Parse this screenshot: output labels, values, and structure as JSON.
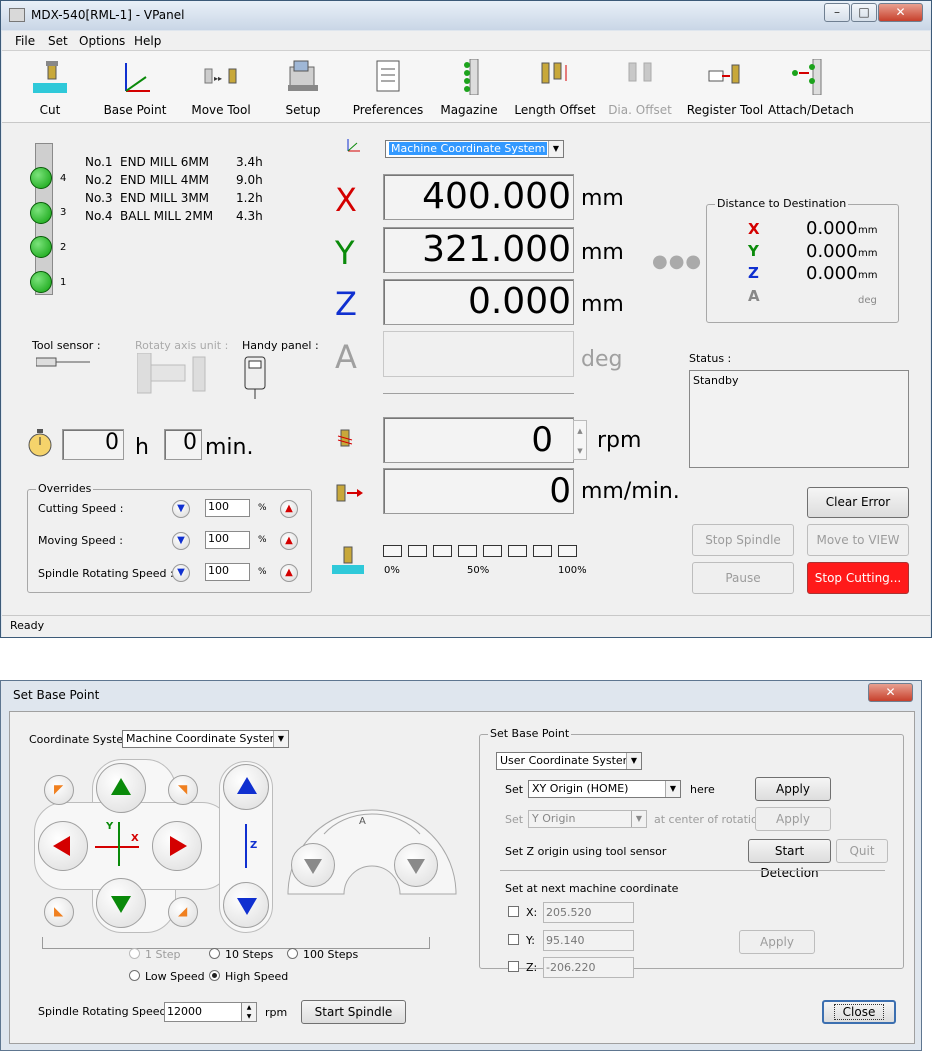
{
  "vpanel": {
    "title": "MDX-540[RML-1] - VPanel",
    "menu": [
      "File",
      "Set",
      "Options",
      "Help"
    ],
    "toolbar": [
      "Cut",
      "Base Point",
      "Move Tool",
      "Setup",
      "Preferences",
      "Magazine",
      "Length Offset",
      "Dia. Offset",
      "Register Tool",
      "Attach/Detach"
    ],
    "tools": [
      {
        "no": "No.1",
        "name": "END MILL 6MM",
        "time": "3.4h"
      },
      {
        "no": "No.2",
        "name": "END MILL 4MM",
        "time": "9.0h"
      },
      {
        "no": "No.3",
        "name": "END MILL 3MM",
        "time": "1.2h"
      },
      {
        "no": "No.4",
        "name": "BALL MILL 2MM",
        "time": "4.3h"
      }
    ],
    "slots": [
      "4",
      "3",
      "2",
      "1"
    ],
    "sensors": {
      "tool": "Tool sensor :",
      "rotary": "Rotaty axis unit :",
      "handy": "Handy panel :"
    },
    "timer": {
      "hours": "0",
      "h": "h",
      "minutes": "0",
      "min": "min."
    },
    "overrides": {
      "caption": "Overrides",
      "rows": [
        {
          "label": "Cutting Speed :",
          "value": "100",
          "pct": "%"
        },
        {
          "label": "Moving Speed :",
          "value": "100",
          "pct": "%"
        },
        {
          "label": "Spindle Rotating Speed :",
          "value": "100",
          "pct": "%"
        }
      ]
    },
    "coord_system": "Machine Coordinate System",
    "axes": [
      {
        "name": "X",
        "value": "400.000",
        "unit": "mm",
        "color": "#d40000"
      },
      {
        "name": "Y",
        "value": "321.000",
        "unit": "mm",
        "color": "#0a8a0a"
      },
      {
        "name": "Z",
        "value": "0.000",
        "unit": "mm",
        "color": "#1030d0"
      },
      {
        "name": "A",
        "value": "",
        "unit": "deg",
        "color": "#a0a0a0"
      }
    ],
    "spindle": {
      "value": "0",
      "unit": "rpm"
    },
    "feed": {
      "value": "0",
      "unit": "mm/min."
    },
    "progress": {
      "p0": "0%",
      "p50": "50%",
      "p100": "100%",
      "fraction": 0
    },
    "distance": {
      "caption": "Distance to Destination",
      "rows": [
        {
          "axis": "X",
          "value": "0.000",
          "unit": "mm",
          "color": "#d40000"
        },
        {
          "axis": "Y",
          "value": "0.000",
          "unit": "mm",
          "color": "#0a8a0a"
        },
        {
          "axis": "Z",
          "value": "0.000",
          "unit": "mm",
          "color": "#1030d0"
        },
        {
          "axis": "A",
          "value": "",
          "unit": "deg",
          "color": "#888888"
        }
      ]
    },
    "status": {
      "label": "Status :",
      "text": "Standby"
    },
    "buttons": {
      "clear_error": "Clear Error",
      "stop_spindle": "Stop Spindle",
      "move_to_view": "Move to VIEW",
      "pause": "Pause",
      "stop_cutting": "Stop Cutting..."
    },
    "statusbar": "Ready"
  },
  "dialog": {
    "title": "Set Base Point",
    "coord_label": "Coordinate System",
    "coord_value": "Machine Coordinate System",
    "jog_labels": {
      "y": "Y",
      "x": "X",
      "z": "Z",
      "a": "A"
    },
    "steps": [
      "1 Step",
      "10 Steps",
      "100 Steps"
    ],
    "speeds": [
      "Low Speed",
      "High Speed"
    ],
    "spindle_label": "Spindle Rotating Speed",
    "spindle_value": "12000",
    "spindle_unit": "rpm",
    "start_spindle": "Start Spindle",
    "group_caption": "Set Base Point",
    "user_coord": "User Coordinate System",
    "set1": {
      "label": "Set",
      "value": "XY Origin (HOME)",
      "suffix": "here",
      "apply": "Apply"
    },
    "set2": {
      "label": "Set",
      "value": "Y Origin",
      "suffix": "at center of rotation",
      "apply": "Apply"
    },
    "set_z": {
      "label": "Set Z origin using tool sensor",
      "start": "Start Detection",
      "quit": "Quit"
    },
    "next_coord": {
      "label": "Set at next machine coordinate",
      "rows": [
        {
          "axis": "X:",
          "value": "205.520"
        },
        {
          "axis": "Y:",
          "value": "95.140"
        },
        {
          "axis": "Z:",
          "value": "-206.220"
        }
      ],
      "apply": "Apply"
    },
    "close": "Close"
  }
}
